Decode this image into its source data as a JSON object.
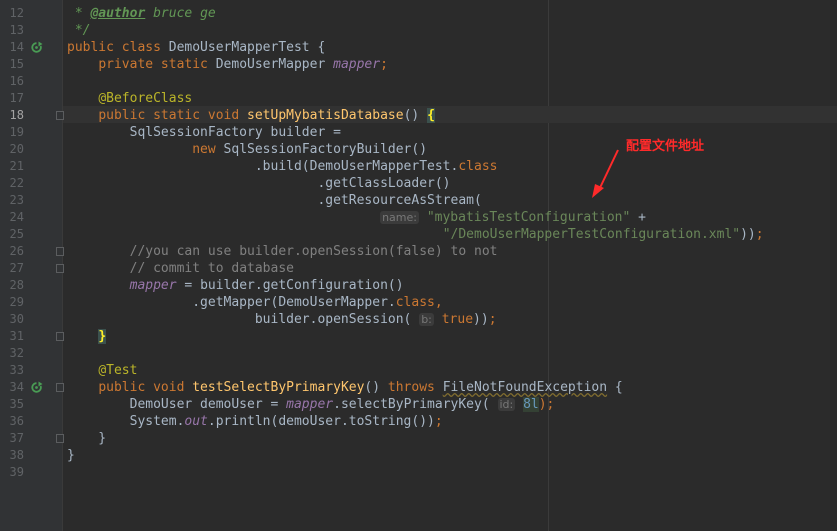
{
  "lines": [
    {
      "n": "12",
      "html": "<span class=\"doc\"> * </span><span class=\"doctag\">@author</span><span class=\"doc\"> bruce ge</span>"
    },
    {
      "n": "13",
      "html": "<span class=\"doc\"> */</span>"
    },
    {
      "n": "14",
      "html": "<span class=\"kw\">public class </span>DemoUserMapperTest {",
      "run": true
    },
    {
      "n": "15",
      "html": "    <span class=\"kw\">private static </span>DemoUserMapper <span class=\"fld\">mapper</span><span class=\"kw\">;</span>"
    },
    {
      "n": "16",
      "html": ""
    },
    {
      "n": "17",
      "html": "    <span class=\"ann\">@BeforeClass</span>"
    },
    {
      "n": "18",
      "html": "    <span class=\"kw\">public static void </span><span class=\"fn\">setUpMybatisDatabase</span>() <span class=\"brace-hl\">{</span>",
      "cur": true,
      "fold": true
    },
    {
      "n": "19",
      "html": "        SqlSessionFactory builder ="
    },
    {
      "n": "20",
      "html": "                <span class=\"kw\">new </span>SqlSessionFactoryBuilder()"
    },
    {
      "n": "21",
      "html": "                        .build(DemoUserMapperTest.<span class=\"kw\">class</span>"
    },
    {
      "n": "22",
      "html": "                                .getClassLoader()"
    },
    {
      "n": "23",
      "html": "                                .getResourceAsStream("
    },
    {
      "n": "24",
      "html": "                                        <span class=\"hint\">name:</span> <span class=\"str\">\"mybatisTestConfiguration\"</span> + "
    },
    {
      "n": "25",
      "html": "                                                <span class=\"str\">\"/DemoUserMapperTestConfiguration.xml\"</span>))<span class=\"kw\">;</span>"
    },
    {
      "n": "26",
      "html": "        <span class=\"cmt\">//you can use builder.openSession(false) to not</span>",
      "fold": true
    },
    {
      "n": "27",
      "html": "        <span class=\"cmt\">// commit to database</span>",
      "fold": true
    },
    {
      "n": "28",
      "html": "        <span class=\"fld\">mapper </span>= builder.getConfiguration()"
    },
    {
      "n": "29",
      "html": "                .getMapper(DemoUserMapper.<span class=\"kw\">class,</span>"
    },
    {
      "n": "30",
      "html": "                        builder.openSession( <span class=\"hint\">b:</span> <span class=\"kw\">true</span>))<span class=\"kw\">;</span>"
    },
    {
      "n": "31",
      "html": "    <span class=\"brace-hl\">}</span>",
      "fold": true
    },
    {
      "n": "32",
      "html": ""
    },
    {
      "n": "33",
      "html": "    <span class=\"ann\">@Test</span>"
    },
    {
      "n": "34",
      "html": "    <span class=\"kw\">public void </span><span class=\"fn\">testSelectByPrimaryKey</span>() <span class=\"kw\">throws </span><span class=\"squig\">FileNotFoundException</span> {",
      "run": true,
      "fold": true
    },
    {
      "n": "35",
      "html": "        DemoUser demoUser = <span class=\"fld\">mapper</span>.selectByPrimaryKey( <span class=\"hint\">id:</span> <span class=\"num num-hl\">8l</span><span class=\"kw\">);</span>"
    },
    {
      "n": "36",
      "html": "        System.<span class=\"fld\">out</span>.println(demoUser.toString())<span class=\"kw\">;</span>"
    },
    {
      "n": "37",
      "html": "    }",
      "fold": true
    },
    {
      "n": "38",
      "html": "}"
    },
    {
      "n": "39",
      "html": ""
    }
  ],
  "annotation": {
    "label": "配置文件地址",
    "color": "#ff2a2a"
  },
  "colors": {
    "background": "#2b2b2b",
    "gutter": "#313335",
    "keyword": "#cc7832",
    "string": "#6a8759",
    "annotation": "#bbb529",
    "method": "#ffc66d",
    "field": "#9876aa"
  },
  "icons": {
    "run": "run-test-icon",
    "fold": "fold-marker-icon",
    "arrow": "red-arrow-icon"
  }
}
